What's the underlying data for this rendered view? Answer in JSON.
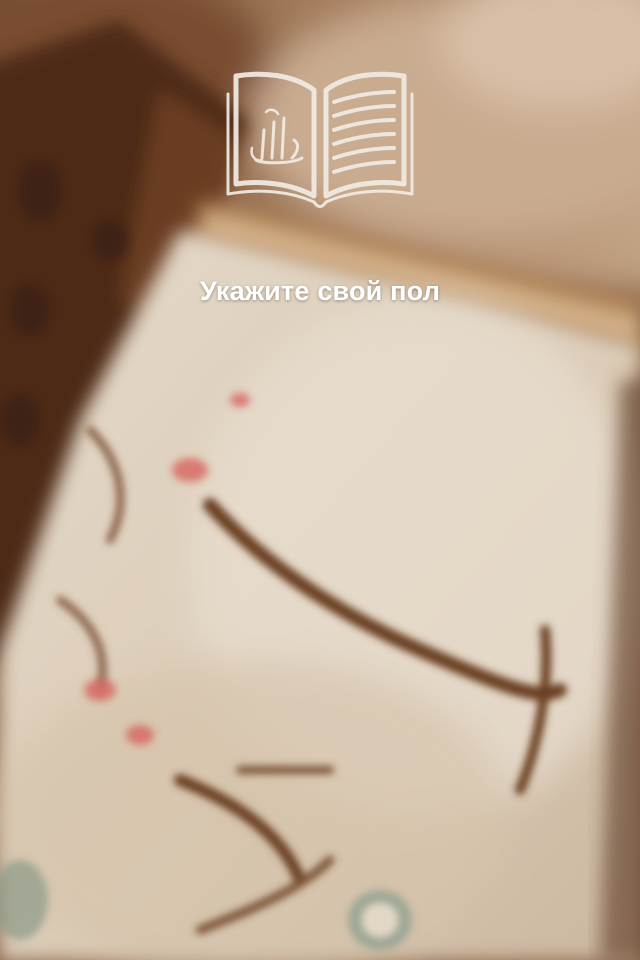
{
  "screen": {
    "title": "Укажите свой пол"
  },
  "logo": {
    "icon": "open-book-calligraphy-icon",
    "color": "#f2ece4"
  },
  "colors": {
    "title_text": "#ffffff",
    "background_paper": "#e2d4c2",
    "background_frame": "#5a3420"
  }
}
